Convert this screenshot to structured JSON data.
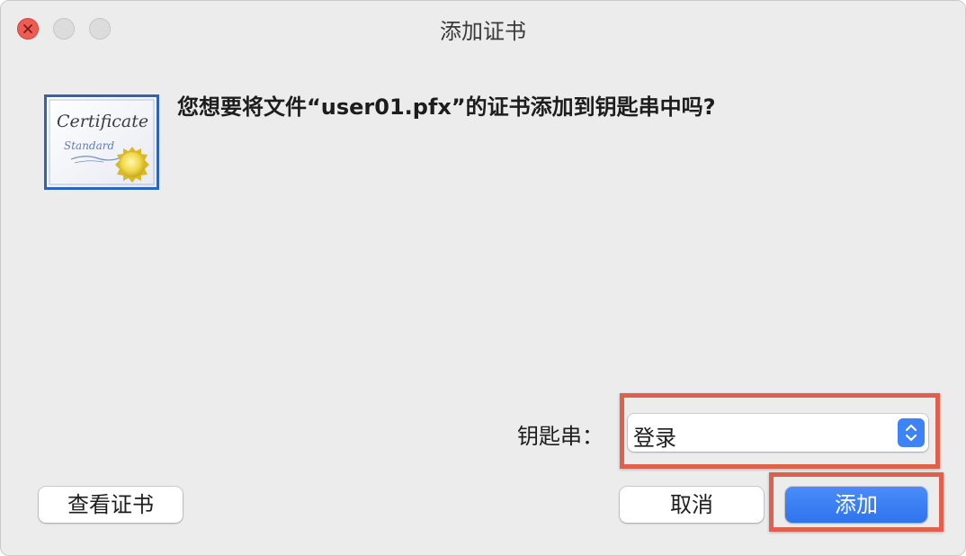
{
  "window": {
    "title": "添加证书"
  },
  "dialog": {
    "question": "您想要将文件“user01.pfx”的证书添加到钥匙串中吗?",
    "certificate_icon": {
      "icon": "certificate-icon",
      "line1": "Certificate",
      "line2": "Standard"
    },
    "keychain_label": "钥匙串：",
    "keychain_value": "登录"
  },
  "buttons": {
    "view_certificate": "查看证书",
    "cancel": "取消",
    "add": "添加"
  },
  "colors": {
    "accent": "#3d82f7",
    "highlight_box": "#e0604e",
    "close_button": "#ee5d55"
  }
}
